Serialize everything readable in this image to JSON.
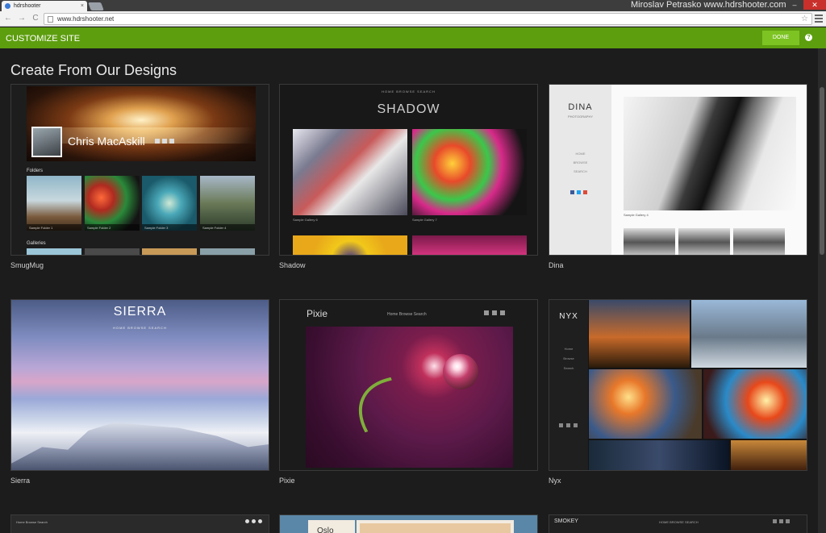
{
  "browser": {
    "tab_title": "hdrshooter",
    "tab_close": "×",
    "url": "www.hdrshooter.net",
    "owner_text": "Miroslav Petrasko  www.hdrshooter.com",
    "back": "←",
    "forward": "→",
    "reload": "C",
    "star": "☆",
    "minimize": "–",
    "close": "✕"
  },
  "customize": {
    "title": "CUSTOMIZE SITE",
    "done_label": "DONE",
    "help": "?"
  },
  "main": {
    "heading": "Create From Our Designs"
  },
  "designs": [
    {
      "name": "SmugMug"
    },
    {
      "name": "Shadow"
    },
    {
      "name": "Dina"
    },
    {
      "name": "Sierra"
    },
    {
      "name": "Pixie"
    },
    {
      "name": "Nyx"
    }
  ],
  "smugmug": {
    "hero_name": "Chris MacAskill",
    "folders_label": "Folders",
    "folders": [
      "Sample Folder 1",
      "Sample Folder 2",
      "Sample Folder 3",
      "Sample Folder 4"
    ],
    "galleries_label": "Galleries"
  },
  "shadow": {
    "nav": "HOME   BROWSE   SEARCH",
    "title": "SHADOW",
    "captions": [
      "Sample Gallery 6",
      "Sample Gallery 7"
    ]
  },
  "dina": {
    "title": "DINA",
    "subtitle": "PHOTOGRAPHY",
    "nav": [
      "HOME",
      "BROWSE",
      "SEARCH"
    ],
    "caption": "Sample Gallery 4"
  },
  "sierra": {
    "title": "SIERRA",
    "nav": "HOME   BROWSE   SEARCH"
  },
  "pixie": {
    "title": "Pixie",
    "nav": "Home   Browse   Search"
  },
  "nyx": {
    "title": "NYX",
    "nav": [
      "Home",
      "Browse",
      "Search"
    ]
  },
  "row3": {
    "nav": "Home   Browse   Search",
    "oslo": "Oslo",
    "smokey": "SMOKEY",
    "smokey_nav": "HOME   BROWSE   SEARCH"
  },
  "colors": {
    "accent_green": "#5d9e0e",
    "done_green": "#7dc423",
    "page_bg": "#1c1c1c"
  }
}
